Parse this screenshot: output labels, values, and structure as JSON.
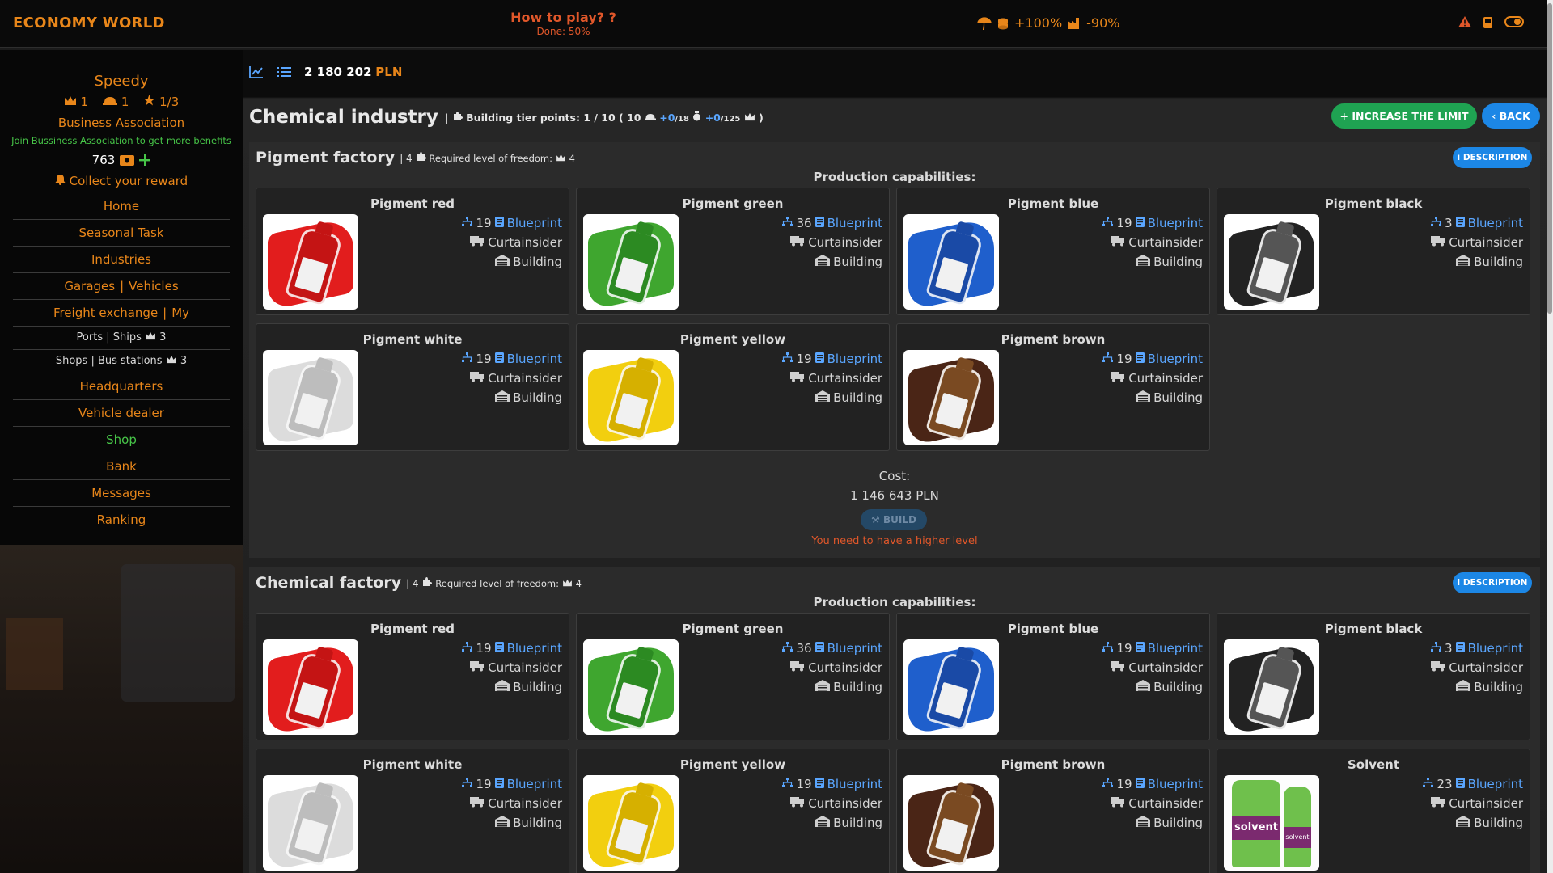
{
  "header": {
    "logo": "ECONOMY WORLD",
    "how_to_play": "How to play? ?",
    "done": "Done: 50%",
    "bonus_up": "+100%",
    "bonus_down": "-90%"
  },
  "sidebar": {
    "username": "Speedy",
    "rank_crown": "1",
    "rank_cap": "1",
    "rank_star": "1/3",
    "association": "Business Association",
    "association_note": "Join Bussiness Association to get more benefits",
    "coins": "763",
    "reward": "Collect your reward",
    "nav": {
      "home": "Home",
      "seasonal": "Seasonal Task",
      "industries": "Industries",
      "garages": "Garages",
      "vehicles": "Vehicles",
      "freight": "Freight exchange",
      "my": "My",
      "ports": "Ports | Ships",
      "ports_lvl": "3",
      "shops": "Shops | Bus stations",
      "shops_lvl": "3",
      "headquarters": "Headquarters",
      "dealer": "Vehicle dealer",
      "shop": "Shop",
      "bank": "Bank",
      "messages": "Messages",
      "ranking": "Ranking"
    }
  },
  "main": {
    "money": "2 180 202",
    "currency": "PLN",
    "title": "Chemical industry",
    "tier_text": "Building tier points: 1 / 10 ( 10",
    "tier_a": "+0",
    "tier_a_max": "/18",
    "tier_b": "+0",
    "tier_b_max": "/125",
    "tier_end": ")",
    "increase_limit": "INCREASE THE LIMIT",
    "back": "BACK"
  },
  "factories": [
    {
      "name": "Pigment factory",
      "tier": "4",
      "required": "Required level of freedom:",
      "required_lvl": "4",
      "description": "DESCRIPTION",
      "production_caps": "Production capabilities:",
      "cost_label": "Cost:",
      "cost_value": "1 146 643 PLN",
      "build": "BUILD",
      "need_level": "You need to have a higher level",
      "products": [
        {
          "name": "Pigment red",
          "count": "19",
          "blueprint": "Blueprint",
          "vehicle": "Curtainsider",
          "building": "Building",
          "color": "#e21d1d",
          "accent": "#c41414"
        },
        {
          "name": "Pigment green",
          "count": "36",
          "blueprint": "Blueprint",
          "vehicle": "Curtainsider",
          "building": "Building",
          "color": "#3fa62f",
          "accent": "#2c8a22"
        },
        {
          "name": "Pigment blue",
          "count": "19",
          "blueprint": "Blueprint",
          "vehicle": "Curtainsider",
          "building": "Building",
          "color": "#1f5fcc",
          "accent": "#1a4aa6"
        },
        {
          "name": "Pigment black",
          "count": "3",
          "blueprint": "Blueprint",
          "vehicle": "Curtainsider",
          "building": "Building",
          "color": "#222222",
          "accent": "#555555"
        },
        {
          "name": "Pigment white",
          "count": "19",
          "blueprint": "Blueprint",
          "vehicle": "Curtainsider",
          "building": "Building",
          "color": "#dcdcdc",
          "accent": "#bdbdbd"
        },
        {
          "name": "Pigment yellow",
          "count": "19",
          "blueprint": "Blueprint",
          "vehicle": "Curtainsider",
          "building": "Building",
          "color": "#f2cf0f",
          "accent": "#d6b000"
        },
        {
          "name": "Pigment brown",
          "count": "19",
          "blueprint": "Blueprint",
          "vehicle": "Curtainsider",
          "building": "Building",
          "color": "#4a2516",
          "accent": "#7a4a22"
        }
      ]
    },
    {
      "name": "Chemical factory",
      "tier": "4",
      "required": "Required level of freedom:",
      "required_lvl": "4",
      "description": "DESCRIPTION",
      "production_caps": "Production capabilities:",
      "products": [
        {
          "name": "Pigment red",
          "count": "19",
          "blueprint": "Blueprint",
          "vehicle": "Curtainsider",
          "building": "Building",
          "color": "#e21d1d",
          "accent": "#c41414"
        },
        {
          "name": "Pigment green",
          "count": "36",
          "blueprint": "Blueprint",
          "vehicle": "Curtainsider",
          "building": "Building",
          "color": "#3fa62f",
          "accent": "#2c8a22"
        },
        {
          "name": "Pigment blue",
          "count": "19",
          "blueprint": "Blueprint",
          "vehicle": "Curtainsider",
          "building": "Building",
          "color": "#1f5fcc",
          "accent": "#1a4aa6"
        },
        {
          "name": "Pigment black",
          "count": "3",
          "blueprint": "Blueprint",
          "vehicle": "Curtainsider",
          "building": "Building",
          "color": "#222222",
          "accent": "#555555"
        },
        {
          "name": "Pigment white",
          "count": "19",
          "blueprint": "Blueprint",
          "vehicle": "Curtainsider",
          "building": "Building",
          "color": "#dcdcdc",
          "accent": "#bdbdbd"
        },
        {
          "name": "Pigment yellow",
          "count": "19",
          "blueprint": "Blueprint",
          "vehicle": "Curtainsider",
          "building": "Building",
          "color": "#f2cf0f",
          "accent": "#d6b000"
        },
        {
          "name": "Pigment brown",
          "count": "19",
          "blueprint": "Blueprint",
          "vehicle": "Curtainsider",
          "building": "Building",
          "color": "#4a2516",
          "accent": "#7a4a22"
        },
        {
          "name": "Solvent",
          "count": "23",
          "blueprint": "Blueprint",
          "vehicle": "Curtainsider",
          "building": "Building",
          "label": "solvent",
          "color": "#6fc04c",
          "accent": "#7b2a6f"
        }
      ]
    }
  ],
  "colors": {
    "accent_orange": "#e8861a",
    "link_blue": "#5aa6ff",
    "button_green": "#1fa352",
    "button_blue": "#1c87e6",
    "warning_red": "#e0572a",
    "note_green": "#47c548"
  }
}
